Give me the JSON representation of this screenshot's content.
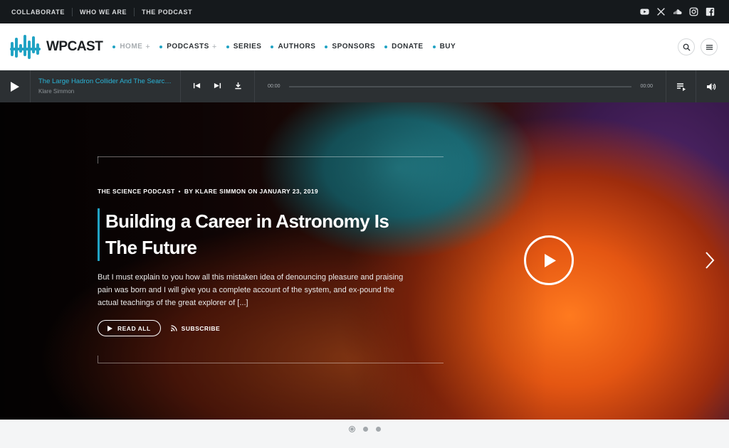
{
  "topbar": {
    "links": [
      "COLLABORATE",
      "WHO WE ARE",
      "THE PODCAST"
    ],
    "socials": [
      "youtube-icon",
      "x-icon",
      "soundcloud-icon",
      "instagram-icon",
      "facebook-icon"
    ]
  },
  "header": {
    "logo_text": "WPCAST",
    "nav": [
      {
        "label": "HOME",
        "plus": "+"
      },
      {
        "label": "PODCASTS",
        "plus": "+"
      },
      {
        "label": "SERIES"
      },
      {
        "label": "AUTHORS"
      },
      {
        "label": "SPONSORS"
      },
      {
        "label": "DONATE"
      },
      {
        "label": "BUY"
      }
    ],
    "active_nav": "HOME",
    "accent": "#21a3c4"
  },
  "player": {
    "title": "The Large Hadron Collider And The Search For New Physics",
    "author": "Klare Simmon",
    "time_current": "00:00",
    "time_total": "00:00",
    "progress": 0
  },
  "hero": {
    "category": "THE SCIENCE PODCAST",
    "bullet": "•",
    "byline": "BY KLARE SIMMON ON JANUARY 23, 2019",
    "title": "Building a Career in Astronomy Is The Future",
    "excerpt": "But I must explain to you how all this mistaken idea of denouncing pleasure and praising pain was born and I will give you a complete account of the system, and ex-pound the actual teachings of the great explorer of [...]",
    "read_label": "READ ALL",
    "subscribe_label": "SUBSCRIBE"
  },
  "slider": {
    "count": 3,
    "active": 0
  }
}
